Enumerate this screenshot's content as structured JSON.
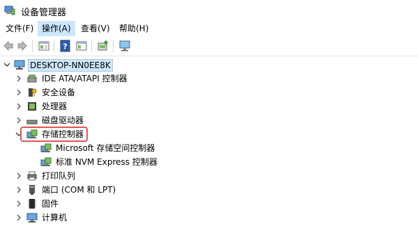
{
  "window": {
    "title": "设备管理器",
    "icon": "device-manager-icon"
  },
  "menu": {
    "items": [
      {
        "label": "文件(F)"
      },
      {
        "label": "操作(A)",
        "active": true
      },
      {
        "label": "查看(V)"
      },
      {
        "label": "帮助(H)"
      }
    ]
  },
  "toolbar": {
    "buttons": [
      "back-icon",
      "forward-icon",
      "properties-icon",
      "help-icon",
      "window-icon",
      "update-driver-icon",
      "monitor-icon"
    ]
  },
  "tree": {
    "root": {
      "label": "DESKTOP-NN0EE8K",
      "icon": "computer-icon",
      "expanded": true
    },
    "nodes": [
      {
        "label": "IDE ATA/ATAPI 控制器",
        "icon": "ide-controller-icon",
        "expanded": false
      },
      {
        "label": "安全设备",
        "icon": "security-device-icon",
        "expanded": false
      },
      {
        "label": "处理器",
        "icon": "processor-icon",
        "expanded": false
      },
      {
        "label": "磁盘驱动器",
        "icon": "disk-drive-icon",
        "expanded": false
      },
      {
        "label": "存储控制器",
        "icon": "storage-controller-icon",
        "expanded": true,
        "highlighted": true,
        "children": [
          {
            "label": "Microsoft 存储空间控制器",
            "icon": "storage-controller-icon"
          },
          {
            "label": "标准 NVM Express 控制器",
            "icon": "storage-controller-icon"
          }
        ]
      },
      {
        "label": "打印队列",
        "icon": "printer-icon",
        "expanded": false
      },
      {
        "label": "端口 (COM 和 LPT)",
        "icon": "port-icon",
        "expanded": false
      },
      {
        "label": "固件",
        "icon": "firmware-icon",
        "expanded": false
      },
      {
        "label": "计算机",
        "icon": "computer-icon",
        "expanded": false
      }
    ]
  },
  "colors": {
    "menu_active": "#cce8ff",
    "root_selected": "#cde8ff",
    "highlight_box": "#e05555"
  }
}
